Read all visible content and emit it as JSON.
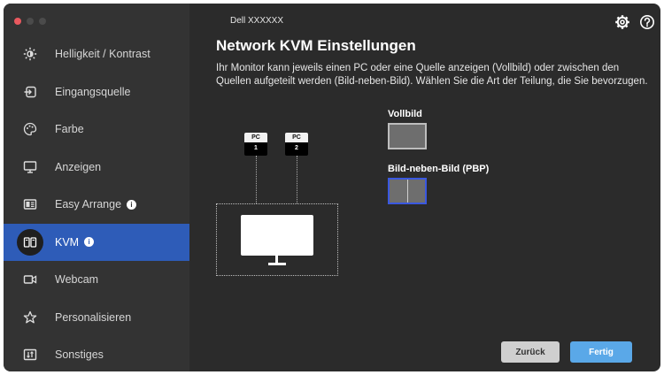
{
  "app": {
    "title": "Dell XXXXXX"
  },
  "sidebar": {
    "items": [
      {
        "label": "Helligkeit / Kontrast",
        "icon": "brightness-icon"
      },
      {
        "label": "Eingangsquelle",
        "icon": "input-source-icon"
      },
      {
        "label": "Farbe",
        "icon": "color-palette-icon"
      },
      {
        "label": "Anzeigen",
        "icon": "display-icon"
      },
      {
        "label": "Easy Arrange",
        "icon": "layout-icon",
        "info": "i"
      },
      {
        "label": "KVM",
        "icon": "kvm-icon",
        "info": "i",
        "active": true
      },
      {
        "label": "Webcam",
        "icon": "webcam-icon"
      },
      {
        "label": "Personalisieren",
        "icon": "star-icon"
      },
      {
        "label": "Sonstiges",
        "icon": "others-icon"
      }
    ]
  },
  "header": {
    "settings_icon": "gear-icon",
    "help_icon": "help-icon"
  },
  "main": {
    "title": "Network KVM Einstellungen",
    "description": "Ihr Monitor kann jeweils einen PC oder eine Quelle anzeigen (Vollbild) oder zwischen den Quellen aufgeteilt werden (Bild-neben-Bild). Wählen Sie die Art der Teilung, die Sie bevorzugen.",
    "pc1": {
      "top": "PC",
      "bottom": "1"
    },
    "pc2": {
      "top": "PC",
      "bottom": "2"
    },
    "options": {
      "full": "Vollbild",
      "pbp": "Bild-neben-Bild (PBP)",
      "selected": "pbp"
    }
  },
  "footer": {
    "back_label": "Zurück",
    "done_label": "Fertig"
  },
  "colors": {
    "accent": "#2e5cb8",
    "done": "#5aa8e8",
    "pbp_border": "#3a58e0"
  }
}
